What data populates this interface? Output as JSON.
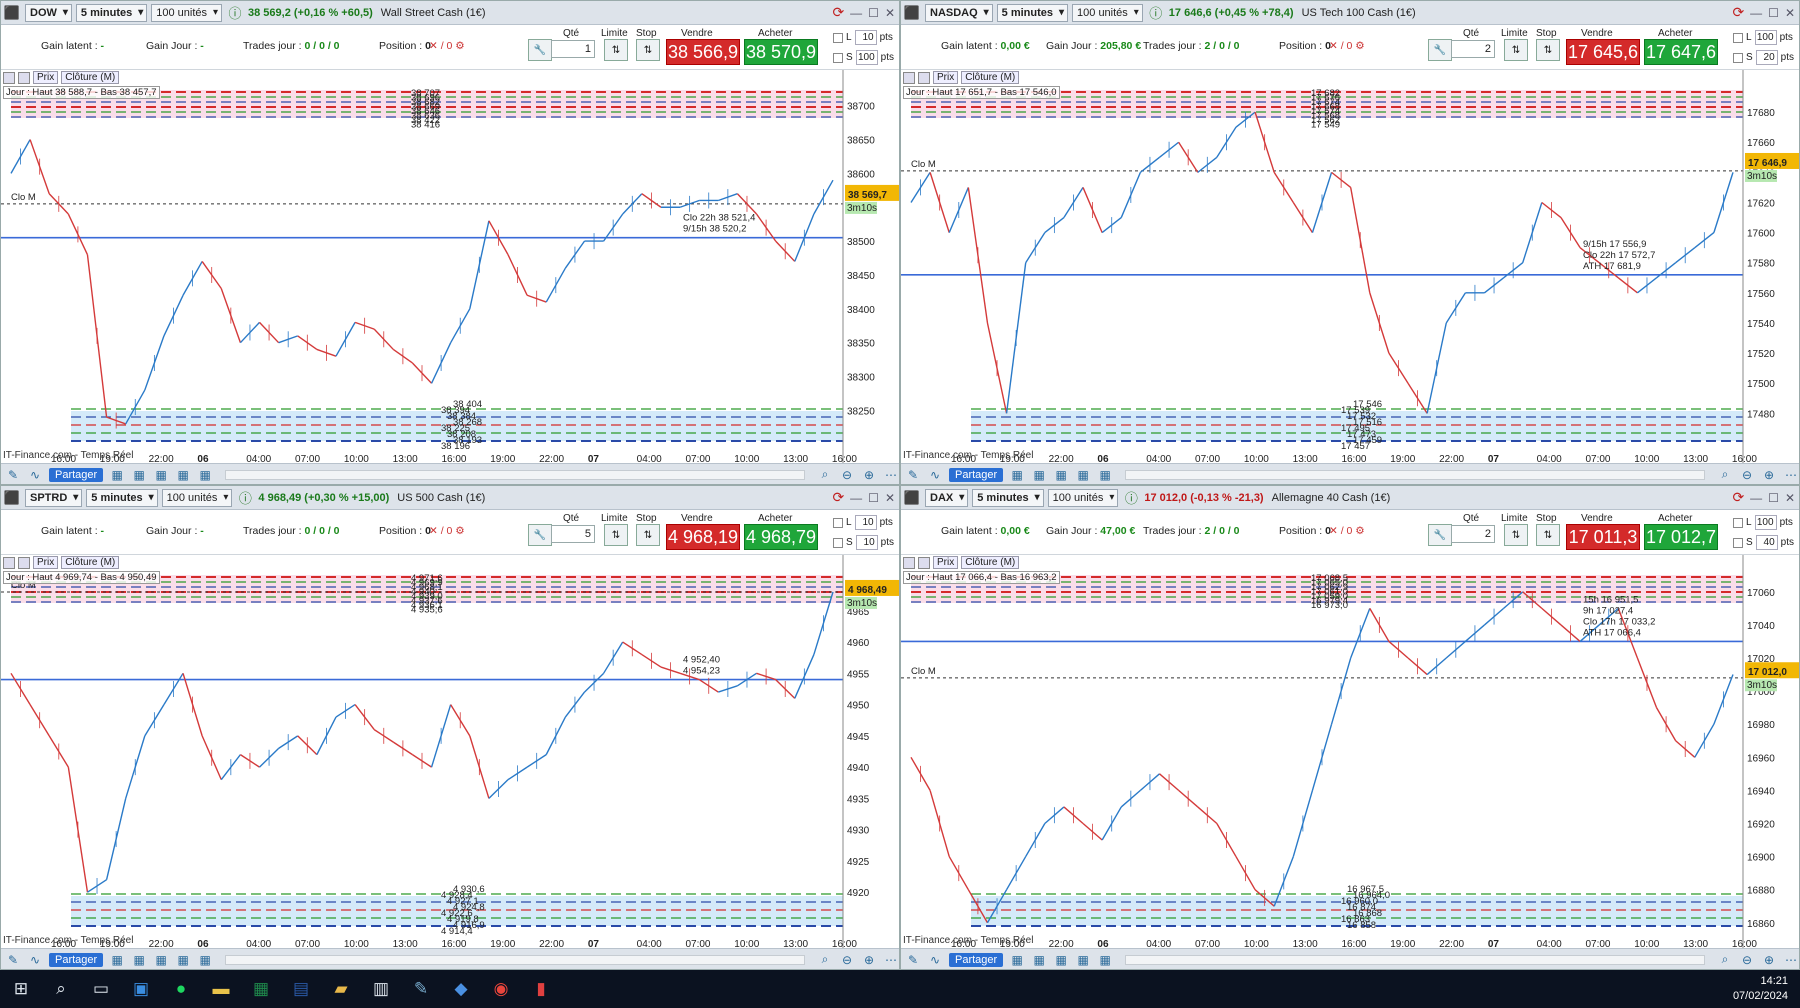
{
  "common": {
    "timeframe": "5 minutes",
    "size": "100 unités",
    "price_label": "Prix",
    "close_label": "Clôture (M)",
    "source": "IT-Finance.com - Temps Réel",
    "share_label": "Partager",
    "gain_latent_label": "Gain latent :",
    "gain_jour_label": "Gain Jour :",
    "trades_label": "Trades jour :",
    "position_label": "Position :",
    "qty_label": "Qté",
    "limit_label": "Limite",
    "stop_label": "Stop",
    "sell_label": "Vendre",
    "buy_label": "Acheter",
    "L_label": "L",
    "S_label": "S",
    "pts_label": "pts",
    "clo_m": "Clo M",
    "countdown": "3m10s",
    "x_ticks": [
      "16:00",
      "19:00",
      "22:00",
      "06",
      "04:00",
      "07:00",
      "10:00",
      "13:00",
      "16:00",
      "19:00",
      "22:00",
      "07",
      "04:00",
      "07:00",
      "10:00",
      "13:00",
      "16:00"
    ]
  },
  "panes": [
    {
      "symbol": "DOW",
      "quote": "38 569,2 (+0,16 % +60,5)",
      "quote_neg": false,
      "instrument": "Wall Street Cash (1€)",
      "gain_latent": "-",
      "gain_jour": "-",
      "trades": "0 / 0 / 0",
      "position": "0",
      "qty": "1",
      "sell_price": "38 566,9",
      "buy_price": "38 570,9",
      "L_pts": "10",
      "S_pts": "100",
      "day_label": "Jour : Haut 38 588,7 - Bas 38 457,7",
      "current_price": "38 569,7",
      "extra_labels": [
        "9/15h 38 520,2",
        "Clo 22h 38 521,4"
      ],
      "chart_data": {
        "type": "line",
        "ylim": [
          38190,
          38735
        ],
        "y_ticks": [
          38700,
          38650,
          38600,
          38550,
          38500,
          38450,
          38400,
          38350,
          38300,
          38250
        ],
        "current": 38569.7,
        "clo_m": 38555,
        "support_line": 38505,
        "levels": [
          "38 707",
          "38 696",
          "38 682",
          "38 669",
          "38 646",
          "38 636",
          "38 422",
          "38 416",
          "38 404",
          "38 394",
          "38 384",
          "38 268",
          "38 225",
          "38 208",
          "38 193",
          "38 196"
        ],
        "path": [
          38600,
          38650,
          38570,
          38540,
          38480,
          38240,
          38230,
          38280,
          38360,
          38420,
          38470,
          38430,
          38350,
          38380,
          38350,
          38360,
          38340,
          38330,
          38380,
          38370,
          38340,
          38320,
          38290,
          38350,
          38400,
          38530,
          38480,
          38420,
          38410,
          38460,
          38500,
          38500,
          38540,
          38570,
          38550,
          38550,
          38560,
          38560,
          38570,
          38540,
          38500,
          38470,
          38540,
          38590
        ]
      }
    },
    {
      "symbol": "NASDAQ",
      "quote": "17 646,6 (+0,45 % +78,4)",
      "quote_neg": false,
      "instrument": "US Tech 100 Cash (1€)",
      "gain_latent": "0,00 €",
      "gain_jour": "205,80 €",
      "trades": "2 / 0 / 0",
      "position": "0",
      "qty": "2",
      "sell_price": "17 645,6",
      "buy_price": "17 647,6",
      "L_pts": "100",
      "S_pts": "20",
      "day_label": "Jour : Haut 17 651,7 - Bas 17 546,0",
      "current_price": "17 646,9",
      "extra_labels": [
        "ATH 17 681,9",
        "Clo 22h 17 572,7",
        "9/15h 17 556,9"
      ],
      "chart_data": {
        "type": "line",
        "ylim": [
          17455,
          17700
        ],
        "y_ticks": [
          17680,
          17660,
          17640,
          17620,
          17600,
          17580,
          17560,
          17540,
          17520,
          17500,
          17480
        ],
        "current": 17646.9,
        "clo_m": 17641,
        "support_line": 17572,
        "levels": [
          "17 682",
          "17 676",
          "17 674",
          "17 668",
          "17 574",
          "17 568",
          "17 562",
          "17 549",
          "17 546",
          "17 539",
          "17 532",
          "17 516",
          "17 495",
          "17 473",
          "17 459",
          "17 457"
        ],
        "path": [
          17620,
          17640,
          17600,
          17630,
          17540,
          17480,
          17580,
          17600,
          17610,
          17630,
          17600,
          17610,
          17640,
          17650,
          17660,
          17640,
          17650,
          17670,
          17680,
          17640,
          17620,
          17600,
          17640,
          17630,
          17560,
          17520,
          17500,
          17480,
          17540,
          17560,
          17560,
          17570,
          17580,
          17620,
          17610,
          17590,
          17580,
          17570,
          17560,
          17570,
          17580,
          17590,
          17600,
          17640
        ]
      }
    },
    {
      "symbol": "SPTRD",
      "quote": "4 968,49 (+0,30 % +15,00)",
      "quote_neg": false,
      "instrument": "US 500 Cash (1€)",
      "gain_latent": "-",
      "gain_jour": "-",
      "trades": "0 / 0 / 0",
      "position": "0",
      "qty": "5",
      "sell_price": "4 968,19",
      "buy_price": "4 968,79",
      "L_pts": "10",
      "S_pts": "10",
      "day_label": "Jour : Haut 4 969,74 - Bas 4 950,49",
      "current_price": "4 968,49",
      "extra_labels": [
        "4 954,23",
        "4 952,40"
      ],
      "chart_data": {
        "type": "line",
        "ylim": [
          4913,
          4972
        ],
        "y_ticks": [
          4965,
          4960,
          4955,
          4950,
          4945,
          4940,
          4935,
          4930,
          4925,
          4920
        ],
        "current": 4968.49,
        "clo_m": 4968,
        "support_line": 4954,
        "levels": [
          "4 971,6",
          "4 969,9",
          "4 968,1",
          "4 940",
          "4 939,0",
          "4 937,6",
          "4 936,1",
          "4 935,6",
          "4 930,6",
          "4 928,4",
          "4 927,1",
          "4 924,8",
          "4 922,6",
          "4 919,8",
          "4 916,9",
          "4 914,4"
        ],
        "path": [
          4955,
          4950,
          4945,
          4940,
          4920,
          4922,
          4935,
          4945,
          4950,
          4955,
          4945,
          4938,
          4942,
          4940,
          4943,
          4945,
          4942,
          4948,
          4950,
          4946,
          4944,
          4942,
          4940,
          4950,
          4945,
          4935,
          4938,
          4940,
          4942,
          4948,
          4952,
          4955,
          4960,
          4958,
          4956,
          4955,
          4954,
          4952,
          4953,
          4955,
          4954,
          4951,
          4958,
          4968
        ]
      }
    },
    {
      "symbol": "DAX",
      "quote": "17 012,0 (-0,13 % -21,3)",
      "quote_neg": true,
      "instrument": "Allemagne 40 Cash (1€)",
      "gain_latent": "0,00 €",
      "gain_jour": "47,00 €",
      "trades": "2 / 0 / 0",
      "position": "0",
      "qty": "2",
      "sell_price": "17 011,3",
      "buy_price": "17 012,7",
      "L_pts": "100",
      "S_pts": "40",
      "day_label": "Jour : Haut 17 066,4 - Bas 16 963,2",
      "current_price": "17 012,0",
      "extra_labels": [
        "ATH 17 066,4",
        "Clo 17h 17 033,2",
        "9h 17 027,4",
        "15h 16 951,5"
      ],
      "chart_data": {
        "type": "line",
        "ylim": [
          16852,
          17075
        ],
        "y_ticks": [
          17060,
          17040,
          17020,
          17000,
          16980,
          16960,
          16940,
          16920,
          16900,
          16880,
          16860
        ],
        "current": 17012.0,
        "clo_m": 17008,
        "support_line": 17030,
        "levels": [
          "17 068,5",
          "17 065,0",
          "17 062,9",
          "17 061,0",
          "17 059,0",
          "16 979,4",
          "16 973,0",
          "16 967,5",
          "16 964,0",
          "16 960,0",
          "16 874",
          "16 868",
          "16 863",
          "16 858"
        ],
        "path": [
          16960,
          16940,
          16900,
          16880,
          16860,
          16880,
          16900,
          16920,
          16930,
          16920,
          16910,
          16930,
          16940,
          16950,
          16940,
          16930,
          16920,
          16900,
          16880,
          16870,
          16900,
          16940,
          16980,
          17020,
          17050,
          17030,
          17020,
          17010,
          17020,
          17030,
          17040,
          17050,
          17060,
          17050,
          17040,
          17030,
          17040,
          17050,
          17020,
          16990,
          16970,
          16960,
          16980,
          17010
        ]
      }
    }
  ],
  "taskbar": {
    "time": "14:21",
    "date": "07/02/2024"
  }
}
